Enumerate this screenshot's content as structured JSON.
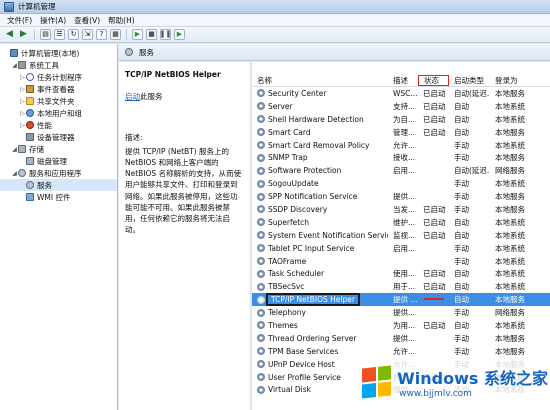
{
  "window": {
    "title": "计算机管理"
  },
  "menu": [
    "文件(F)",
    "操作(A)",
    "查看(V)",
    "帮助(H)"
  ],
  "toolbar_icons": [
    "back-icon",
    "forward-icon",
    "folder-icon",
    "list-icon",
    "refresh-icon",
    "export-icon",
    "help-icon",
    "properties-icon",
    "play-icon",
    "stop-icon",
    "pause-icon",
    "restart-icon"
  ],
  "tree": [
    {
      "label": "计算机管理(本地)",
      "level": 0,
      "icon": "computer-icon",
      "expander": ""
    },
    {
      "label": "系统工具",
      "level": 1,
      "icon": "tools-icon",
      "expander": "◢"
    },
    {
      "label": "任务计划程序",
      "level": 2,
      "icon": "clock-icon",
      "expander": "▷"
    },
    {
      "label": "事件查看器",
      "level": 2,
      "icon": "event-icon",
      "expander": "▷"
    },
    {
      "label": "共享文件夹",
      "level": 2,
      "icon": "folder-icon",
      "expander": "▷"
    },
    {
      "label": "本地用户和组",
      "level": 2,
      "icon": "users-icon",
      "expander": "▷"
    },
    {
      "label": "性能",
      "level": 2,
      "icon": "performance-icon",
      "expander": "▷"
    },
    {
      "label": "设备管理器",
      "level": 2,
      "icon": "device-icon",
      "expander": ""
    },
    {
      "label": "存储",
      "level": 1,
      "icon": "storage-icon",
      "expander": "◢"
    },
    {
      "label": "磁盘管理",
      "level": 2,
      "icon": "disk-icon",
      "expander": ""
    },
    {
      "label": "服务和应用程序",
      "level": 1,
      "icon": "services-apps-icon",
      "expander": "◢"
    },
    {
      "label": "服务",
      "level": 2,
      "icon": "services-icon",
      "expander": ""
    },
    {
      "label": "WMI 控件",
      "level": 2,
      "icon": "wmi-icon",
      "expander": ""
    }
  ],
  "header": {
    "title": "服务"
  },
  "details": {
    "service_title": "TCP/IP NetBIOS Helper",
    "action_link": "启动",
    "action_text": "此服务",
    "desc_label": "描述:",
    "desc_text": "提供 TCP/IP (NetBT) 服务上的 NetBIOS 和网络上客户端的 NetBIOS 名称解析的支持，从而使用户能够共享文件、打印和登录到网络。如果此服务被停用，这些功能可能不可用。如果此服务被禁用，任何依赖它的服务将无法启动。"
  },
  "columns": {
    "name": "名称",
    "desc": "描述",
    "status": "状态",
    "startup": "启动类型",
    "logon": "登录为"
  },
  "services": [
    {
      "name": "Security Center",
      "desc": "WSC...",
      "status": "已启动",
      "startup": "自动(延迟...",
      "logon": "本地服务"
    },
    {
      "name": "Server",
      "desc": "支持...",
      "status": "已启动",
      "startup": "自动",
      "logon": "本地系统"
    },
    {
      "name": "Shell Hardware Detection",
      "desc": "为自...",
      "status": "已启动",
      "startup": "自动",
      "logon": "本地系统"
    },
    {
      "name": "Smart Card",
      "desc": "管理...",
      "status": "已启动",
      "startup": "自动",
      "logon": "本地服务"
    },
    {
      "name": "Smart Card Removal Policy",
      "desc": "允许...",
      "status": "",
      "startup": "手动",
      "logon": "本地系统"
    },
    {
      "name": "SNMP Trap",
      "desc": "接收...",
      "status": "",
      "startup": "手动",
      "logon": "本地服务"
    },
    {
      "name": "Software Protection",
      "desc": "启用...",
      "status": "",
      "startup": "自动(延迟...",
      "logon": "网络服务"
    },
    {
      "name": "SogouUpdate",
      "desc": "",
      "status": "",
      "startup": "手动",
      "logon": "本地系统"
    },
    {
      "name": "SPP Notification Service",
      "desc": "提供...",
      "status": "",
      "startup": "手动",
      "logon": "本地服务"
    },
    {
      "name": "SSDP Discovery",
      "desc": "当发...",
      "status": "已启动",
      "startup": "手动",
      "logon": "本地服务"
    },
    {
      "name": "Superfetch",
      "desc": "维护...",
      "status": "已启动",
      "startup": "自动",
      "logon": "本地系统"
    },
    {
      "name": "System Event Notification Service",
      "desc": "监视...",
      "status": "已启动",
      "startup": "自动",
      "logon": "本地系统"
    },
    {
      "name": "Tablet PC Input Service",
      "desc": "启用...",
      "status": "",
      "startup": "手动",
      "logon": "本地系统"
    },
    {
      "name": "TAOFrame",
      "desc": "",
      "status": "",
      "startup": "手动",
      "logon": "本地系统"
    },
    {
      "name": "Task Scheduler",
      "desc": "使用...",
      "status": "已启动",
      "startup": "自动",
      "logon": "本地系统"
    },
    {
      "name": "TBSecSvc",
      "desc": "用于...",
      "status": "已启动",
      "startup": "自动",
      "logon": "本地系统"
    },
    {
      "name": "TCP/IP NetBIOS Helper",
      "desc": "提供 ...",
      "status": "",
      "startup": "自动",
      "logon": "本地服务"
    },
    {
      "name": "Telephony",
      "desc": "提供...",
      "status": "",
      "startup": "手动",
      "logon": "网络服务"
    },
    {
      "name": "Themes",
      "desc": "为用...",
      "status": "已启动",
      "startup": "自动",
      "logon": "本地系统"
    },
    {
      "name": "Thread Ordering Server",
      "desc": "提供...",
      "status": "",
      "startup": "手动",
      "logon": "本地服务"
    },
    {
      "name": "TPM Base Services",
      "desc": "允许...",
      "status": "",
      "startup": "手动",
      "logon": "本地服务"
    },
    {
      "name": "UPnP Device Host",
      "desc": "允许...",
      "status": "",
      "startup": "手动",
      "logon": "本地服务"
    },
    {
      "name": "User Profile Service",
      "desc": "此服...",
      "status": "已启动",
      "startup": "自动",
      "logon": "本地系统"
    },
    {
      "name": "Virtual Disk",
      "desc": "提供...",
      "status": "",
      "startup": "手动",
      "logon": "本地系统"
    }
  ],
  "watermark": {
    "brand": "Windows",
    "suffix": "系统之家",
    "url": "www.bjjmlv.com",
    "colors": [
      "#f25022",
      "#7fba00",
      "#00a4ef",
      "#ffb900"
    ]
  }
}
